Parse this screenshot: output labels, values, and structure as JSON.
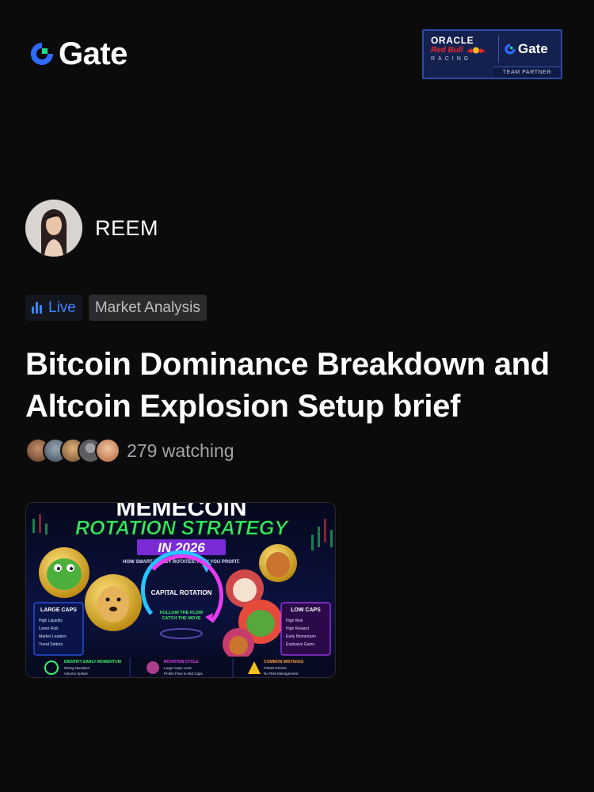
{
  "header": {
    "logo_text": "Gate",
    "logo_icon": "gate-logo-icon",
    "partner_badge": {
      "oracle": "ORACLE",
      "redbull": "Red Bull",
      "racing": "RACING",
      "gate": "Gate",
      "team_partner": "TEAM PARTNER"
    }
  },
  "author": {
    "name": "REEM",
    "avatar_icon": "avatar"
  },
  "tags": {
    "live": "Live",
    "category": "Market Analysis"
  },
  "post": {
    "title": "Bitcoin Dominance Breakdown and Altcoin Explosion Setup brief",
    "watching": "279 watching"
  },
  "thumbnail": {
    "headline_top": "MEMECOIN",
    "headline": "ROTATION STRATEGY",
    "year": "IN 2026",
    "tagline": "HOW SMART MONEY ROTATES. HOW YOU PROFIT.",
    "center_title": "CAPITAL ROTATION",
    "center_sub1": "FOLLOW THE FLOW",
    "center_sub2": "CATCH THE MOVE",
    "left_panel_title": "LARGE CAPS",
    "left_items": [
      "High Liquidity",
      "Lower Risk",
      "Market Leaders",
      "Trend Setters"
    ],
    "right_panel_title": "LOW CAPS",
    "right_items": [
      "High Risk",
      "High Reward",
      "Early Momentum",
      "Explosive Gains"
    ],
    "bottom_1_title": "IDENTIFY EARLY MOMENTUM",
    "bottom_1_items": [
      "Rising Narrative",
      "Volume Spikes"
    ],
    "bottom_2_title": "ROTATION CYCLE",
    "bottom_2_items": [
      "Large Caps Lead",
      "Profits Flow to Mid Caps"
    ],
    "bottom_3_title": "COMMON MISTAKES",
    "bottom_3_items": [
      "FOMO Entries",
      "No Risk Management"
    ],
    "colors": {
      "bg": "#0a0f2a",
      "green": "#3cf06a",
      "purple": "#7a2bd6",
      "cyan": "#23c6ff",
      "magenta": "#e63cf0"
    }
  }
}
